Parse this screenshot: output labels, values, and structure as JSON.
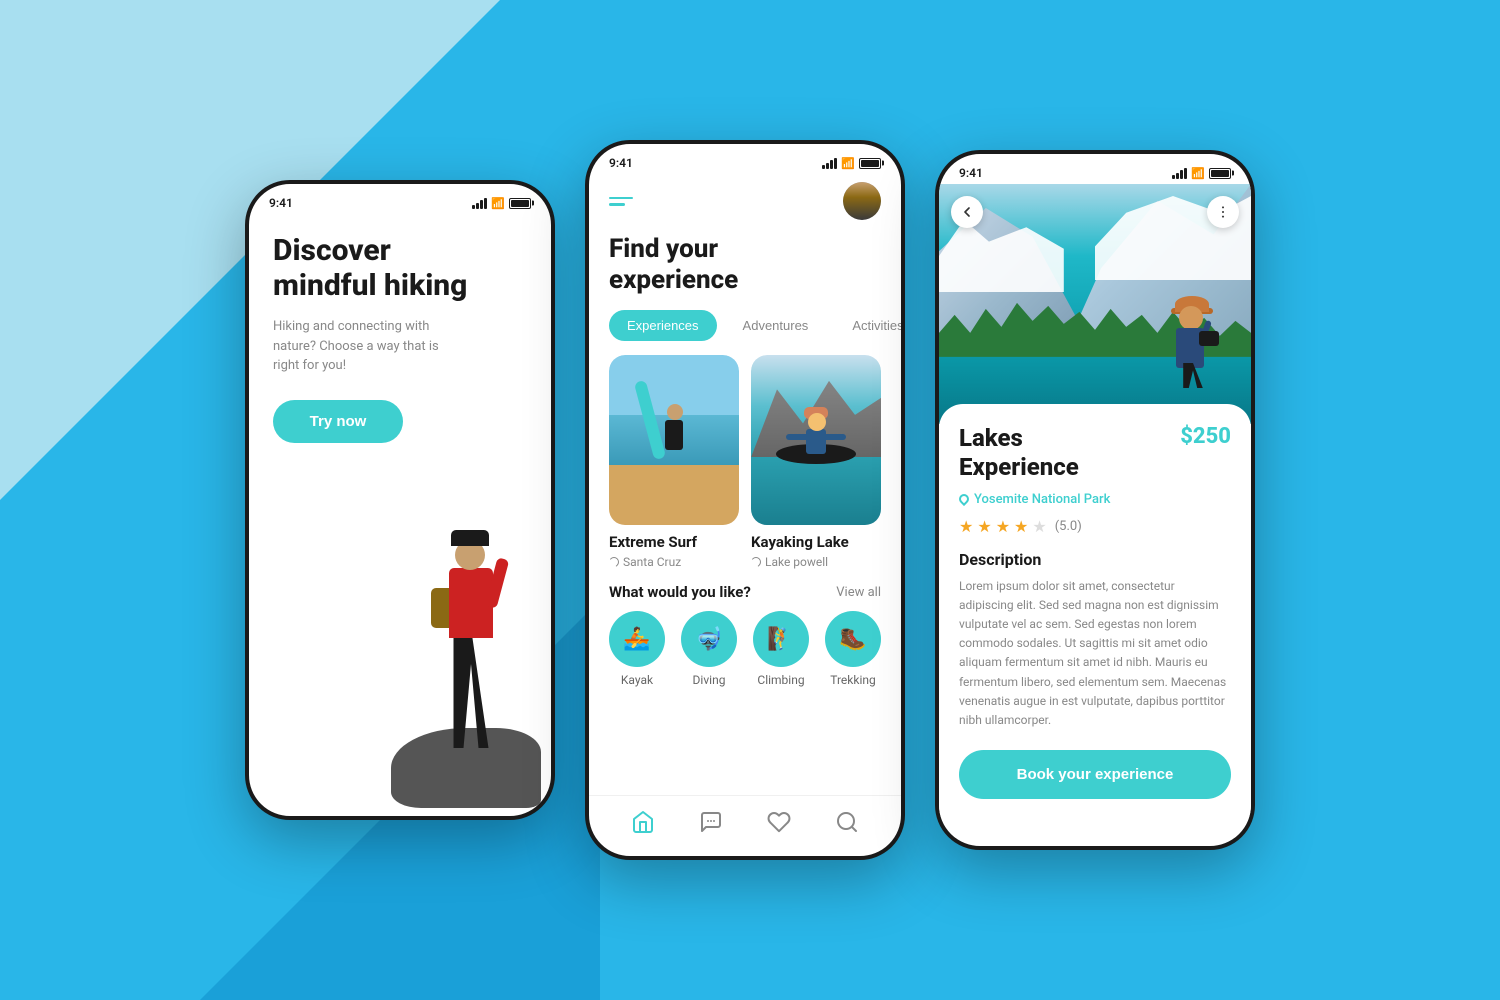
{
  "background": {
    "color": "#29b6e8"
  },
  "phone1": {
    "status_time": "9:41",
    "headline_line1": "Discover",
    "headline_line2": "mindful hiking",
    "subtitle": "Hiking and connecting with nature? Choose a way that is right for you!",
    "cta_button": "Try now"
  },
  "phone2": {
    "status_time": "9:41",
    "title_line1": "Find your",
    "title_line2": "experience",
    "tabs": [
      {
        "label": "Experiences",
        "active": true
      },
      {
        "label": "Adventures",
        "active": false
      },
      {
        "label": "Activities",
        "active": false
      }
    ],
    "cards": [
      {
        "title": "Extreme Surf",
        "location": "Santa Cruz",
        "type": "beach"
      },
      {
        "title": "Kayaking Lake",
        "location": "Lake powell",
        "type": "lake"
      }
    ],
    "what_section_title": "What would you like?",
    "view_all_label": "View all",
    "activities": [
      {
        "label": "Kayak",
        "icon": "🚣"
      },
      {
        "label": "Diving",
        "icon": "🤿"
      },
      {
        "label": "Climbing",
        "icon": "🧗"
      },
      {
        "label": "Trekking",
        "icon": "🥾"
      }
    ],
    "nav_items": [
      "home",
      "chat",
      "heart",
      "search"
    ]
  },
  "phone3": {
    "status_time": "9:41",
    "title": "Lakes\nExperience",
    "price": "$250",
    "location": "Yosemite National Park",
    "rating_value": "5.0",
    "stars_filled": 4,
    "stars_empty": 1,
    "description_title": "Description",
    "description_text": "Lorem ipsum dolor sit amet, consectetur adipiscing elit. Sed sed magna non est dignissim vulputate vel ac sem. Sed egestas non lorem commodo sodales. Ut sagittis mi sit amet odio aliquam fermentum sit amet id nibh. Mauris eu fermentum libero, sed elementum sem. Maecenas venenatis augue in est vulputate, dapibus porttitor nibh ullamcorper.",
    "book_button": "Book your experience"
  }
}
